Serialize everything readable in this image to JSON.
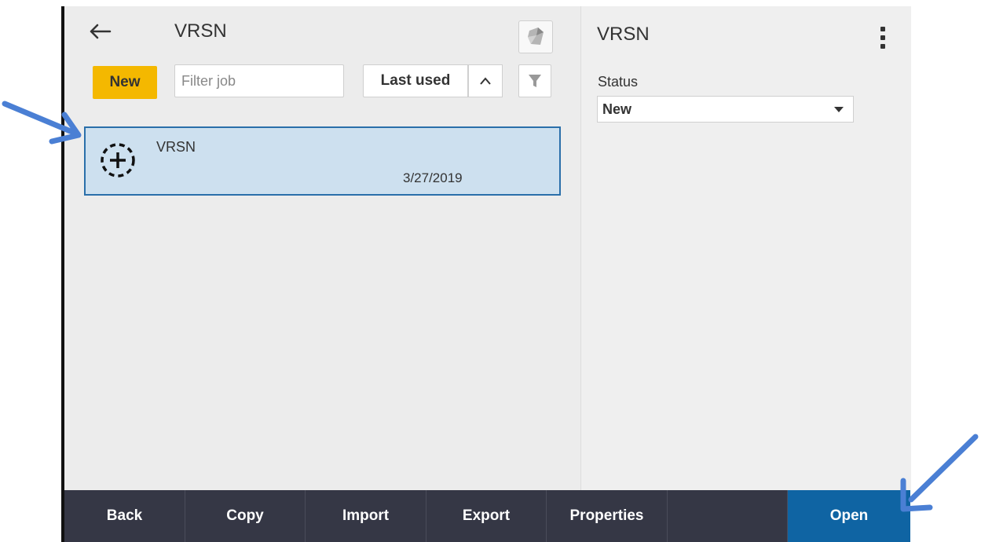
{
  "left_header": {
    "title": "VRSN",
    "back_icon": "back-arrow-icon",
    "logo_icon": "trimble-logo-icon"
  },
  "toolbar": {
    "new_label": "New",
    "filter_placeholder": "Filter job",
    "sort_label": "Last used",
    "sort_dir_icon": "chevron-up-icon",
    "filter_icon": "funnel-icon"
  },
  "jobs": [
    {
      "name": "VRSN",
      "date": "3/27/2019",
      "icon": "new-job-dashed-plus-icon",
      "selected": true
    }
  ],
  "right_panel": {
    "title": "VRSN",
    "menu_icon": "more-vertical-icon",
    "status_label": "Status",
    "status_value": "New"
  },
  "bottom_bar": {
    "buttons": [
      "Back",
      "Copy",
      "Import",
      "Export",
      "Properties",
      "",
      "Open"
    ]
  },
  "colors": {
    "accent_yellow": "#f4b800",
    "selected_row": "#cde0ef",
    "primary_blue": "#0f64a3",
    "bottom_bar": "#353745",
    "annotation_arrow": "#4a7fd4"
  }
}
